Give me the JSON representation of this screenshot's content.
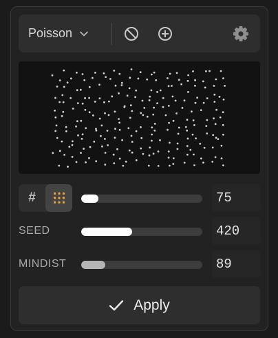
{
  "toolbar": {
    "distribution": "Poisson",
    "icons": [
      "chevron-down-icon",
      "clear-icon",
      "add-icon",
      "gear-icon"
    ]
  },
  "preview": {
    "dot_color": "#cfcfcf",
    "background": "#121212"
  },
  "count": {
    "value": "75",
    "fraction": 0.14
  },
  "seed": {
    "label": "SEED",
    "value": "420",
    "fraction": 0.42
  },
  "mindist": {
    "label": "MINDIST",
    "value": "89",
    "fraction": 0.2
  },
  "apply": {
    "label": "Apply"
  },
  "colors": {
    "accent": "#e8a238",
    "fill_bright": "#ffffff",
    "fill_dim": "#b5b5b5"
  }
}
